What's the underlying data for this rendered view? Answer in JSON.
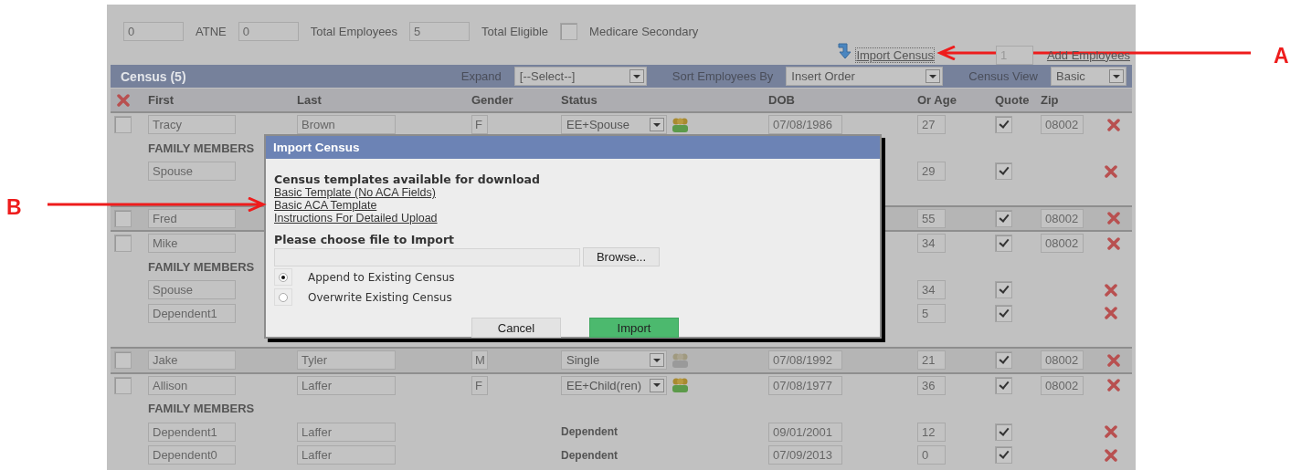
{
  "summary": {
    "items": [
      {
        "kind": "input",
        "value": "0"
      },
      {
        "kind": "label",
        "text": "ATNE"
      },
      {
        "kind": "input",
        "value": "0"
      },
      {
        "kind": "label",
        "text": "Total Employees"
      },
      {
        "kind": "input",
        "value": "5"
      },
      {
        "kind": "label",
        "text": "Total Eligible"
      },
      {
        "kind": "checkbox",
        "checked": false
      },
      {
        "kind": "label",
        "text": "Medicare Secondary"
      }
    ]
  },
  "actions": {
    "import_link": "Import Census",
    "add_count": "1",
    "add_link": "Add Employees"
  },
  "census_bar": {
    "title": "Census (5)",
    "controls": [
      {
        "label": "Expand",
        "value": "[--Select--]"
      },
      {
        "label": "Sort Employees By",
        "value": "Insert Order"
      },
      {
        "label": "Census View",
        "value": "Basic"
      }
    ]
  },
  "table": {
    "columns": [
      "First",
      "Last",
      "Gender",
      "Status",
      "DOB",
      "Or Age",
      "Quote",
      "Zip"
    ],
    "employees": [
      {
        "selected": false,
        "first": "Tracy",
        "last": "Brown",
        "gender": "F",
        "status": "EE+Spouse",
        "dob": "07/08/1986",
        "age": "27",
        "quote": true,
        "zip": "08002",
        "family_label": "FAMILY MEMBERS",
        "members": [
          {
            "first": "Spouse",
            "age": "29",
            "quote": true
          }
        ]
      },
      {
        "selected": false,
        "first": "Fred",
        "age": "55",
        "quote": true,
        "zip": "08002"
      },
      {
        "selected": false,
        "first": "Mike",
        "age": "34",
        "quote": true,
        "zip": "08002",
        "family_label": "FAMILY MEMBERS",
        "members": [
          {
            "first": "Spouse",
            "age": "34",
            "quote": true
          },
          {
            "first": "Dependent1",
            "age": "5",
            "quote": true
          }
        ]
      },
      {
        "selected": false,
        "first": "Jake",
        "last": "Tyler",
        "gender": "M",
        "status": "Single",
        "dob": "07/08/1992",
        "age": "21",
        "quote": true,
        "zip": "08002"
      },
      {
        "selected": false,
        "first": "Allison",
        "last": "Laffer",
        "gender": "F",
        "status": "EE+Child(ren)",
        "dob": "07/08/1977",
        "age": "36",
        "quote": true,
        "zip": "08002",
        "family_label": "FAMILY MEMBERS",
        "members": [
          {
            "first": "Dependent1",
            "last": "Laffer",
            "relation": "Dependent",
            "dob": "09/01/2001",
            "age": "12",
            "quote": true
          },
          {
            "first": "Dependent0",
            "last": "Laffer",
            "relation": "Dependent",
            "dob": "07/09/2013",
            "age": "0",
            "quote": true
          }
        ]
      }
    ]
  },
  "modal": {
    "title": "Import Census",
    "templates_heading": "Census templates available for download",
    "links": [
      "Basic Template (No ACA Fields)",
      "Basic ACA Template",
      "Instructions For Detailed Upload"
    ],
    "file_heading": "Please choose file to Import",
    "browse": "Browse...",
    "options": [
      {
        "label": "Append to Existing Census",
        "selected": true
      },
      {
        "label": "Overwrite Existing Census",
        "selected": false
      }
    ],
    "buttons": [
      {
        "label": "Cancel",
        "kind": "secondary"
      },
      {
        "label": "Import",
        "kind": "primary"
      }
    ]
  },
  "annotations": [
    {
      "label": "A"
    },
    {
      "label": "B"
    }
  ]
}
